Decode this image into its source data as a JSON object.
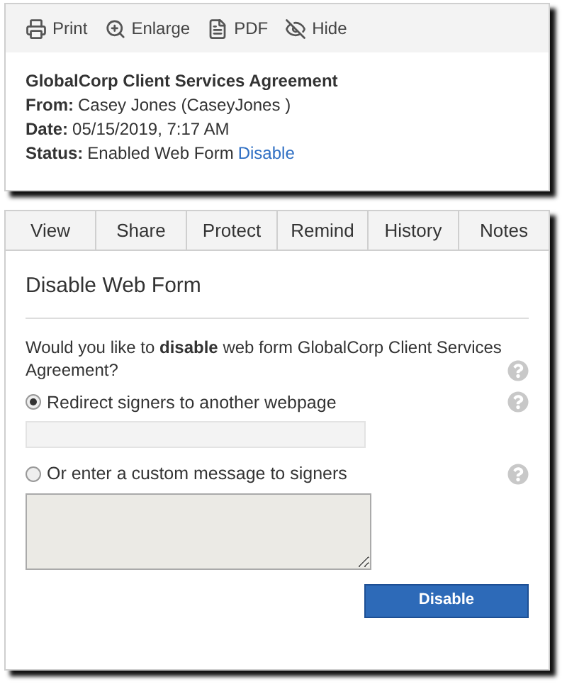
{
  "toolbar": [
    {
      "kind": "print",
      "label": "Print"
    },
    {
      "kind": "enlarge",
      "label": "Enlarge"
    },
    {
      "kind": "pdf",
      "label": "PDF"
    },
    {
      "kind": "hide",
      "label": "Hide"
    }
  ],
  "details": {
    "title": "GlobalCorp Client Services Agreement",
    "fields": [
      {
        "label": "From:",
        "value": "Casey Jones (CaseyJones )"
      },
      {
        "label": "Date:",
        "value": "05/15/2019, 7:17 AM"
      },
      {
        "label": "Status:",
        "value": "Enabled Web Form",
        "link": "Disable"
      }
    ]
  },
  "tabs": [
    {
      "label": "View",
      "selected": false
    },
    {
      "label": "Share",
      "selected": false
    },
    {
      "label": "Protect",
      "selected": false
    },
    {
      "label": "Remind",
      "selected": false
    },
    {
      "label": "History",
      "selected": false
    },
    {
      "label": "Notes",
      "selected": false
    }
  ],
  "form": {
    "heading": "Disable Web Form",
    "question": "Would you like to **disable** web form GlobalCorp Client Services Agreement?",
    "options": [
      {
        "label": "Redirect signers to another webpage",
        "selected": true,
        "kind": "text-input"
      },
      {
        "label": "Or enter a custom message to signers",
        "selected": false,
        "kind": "textarea"
      }
    ],
    "button": "Disable"
  }
}
